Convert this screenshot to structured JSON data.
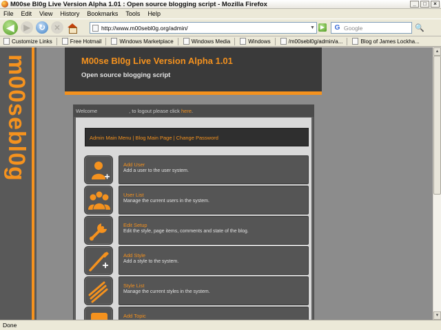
{
  "window": {
    "title": "M00se Bl0g Live Version Alpha 1.01 : Open source blogging script - Mozilla Firefox",
    "minimize": "_",
    "maximize": "□",
    "close": "×"
  },
  "menubar": [
    "File",
    "Edit",
    "View",
    "History",
    "Bookmarks",
    "Tools",
    "Help"
  ],
  "navigation": {
    "url": "http://www.m00sebl0g.org/admin/",
    "search_placeholder": "Google",
    "back_glyph": "◀",
    "forward_glyph": "▶",
    "reload_glyph": "↻",
    "stop_glyph": "✕",
    "go_glyph": "▶",
    "search_go_glyph": "🔍"
  },
  "bookmarks": [
    "Customize Links",
    "Free Hotmail",
    "Windows Marketplace",
    "Windows Media",
    "Windows",
    "/m00sebl0g/admin/a...",
    "Blog of James Lockha..."
  ],
  "site": {
    "logo": "m00sebl0g",
    "title": "M00se Bl0g Live Version Alpha 1.01",
    "subtitle": "Open source blogging script",
    "accent_color": "#f5921e"
  },
  "welcome": {
    "prefix": "Welcome",
    "middle": ", to logout please click",
    "link": "here",
    "suffix": "."
  },
  "admin_menu": {
    "text": "Admin Main Menu | Blog Main Page | Change Password"
  },
  "admin_items": [
    {
      "name": "Add User",
      "description": "Add a user to the user system.",
      "icon": "user-add-icon"
    },
    {
      "name": "User List",
      "description": "Manage the current users in the system.",
      "icon": "users-icon"
    },
    {
      "name": "Edit Setup",
      "description": "Edit the style, page items, comments and state of the blog.",
      "icon": "wrench-icon"
    },
    {
      "name": "Add Style",
      "description": "Add a style to the system.",
      "icon": "brush-add-icon"
    },
    {
      "name": "Style List",
      "description": "Manage the current styles in the system.",
      "icon": "brushes-icon"
    },
    {
      "name": "Add Topic",
      "description": "",
      "icon": "topic-icon"
    }
  ],
  "status": "Done"
}
